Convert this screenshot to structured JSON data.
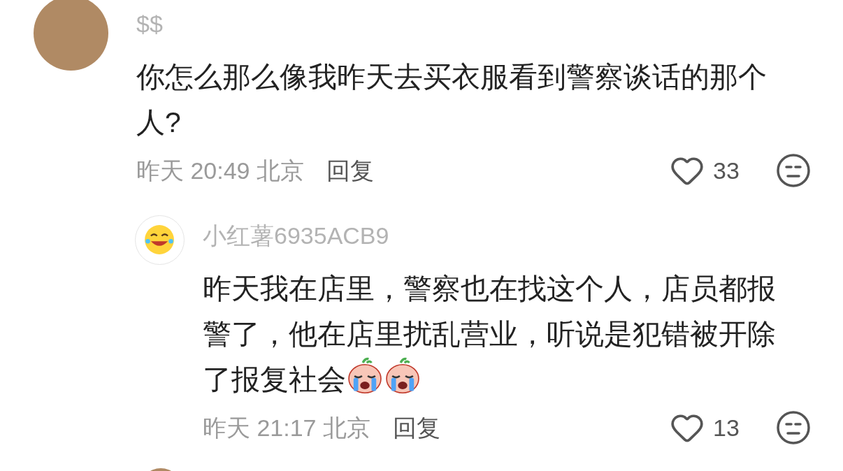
{
  "comments": [
    {
      "avatar": {
        "kind": "photo"
      },
      "author": "$$",
      "text": "你怎么那么像我昨天去买衣服看到警察谈话的那个人?",
      "time": "昨天 20:49 北京",
      "reply_label": "回复",
      "likes": "33",
      "replies": [
        {
          "avatar": {
            "kind": "emoji"
          },
          "author": "小红薯6935ACB9",
          "text": "昨天我在店里，警察也在找这个人，店员都报警了，他在店里扰乱营业，听说是犯错被开除了报复社会",
          "stickers": [
            {
              "kind": "crying"
            },
            {
              "kind": "crying"
            }
          ],
          "time": "昨天 21:17 北京",
          "reply_label": "回复",
          "likes": "13"
        }
      ]
    },
    {
      "avatar": {
        "kind": "photo"
      }
    }
  ]
}
